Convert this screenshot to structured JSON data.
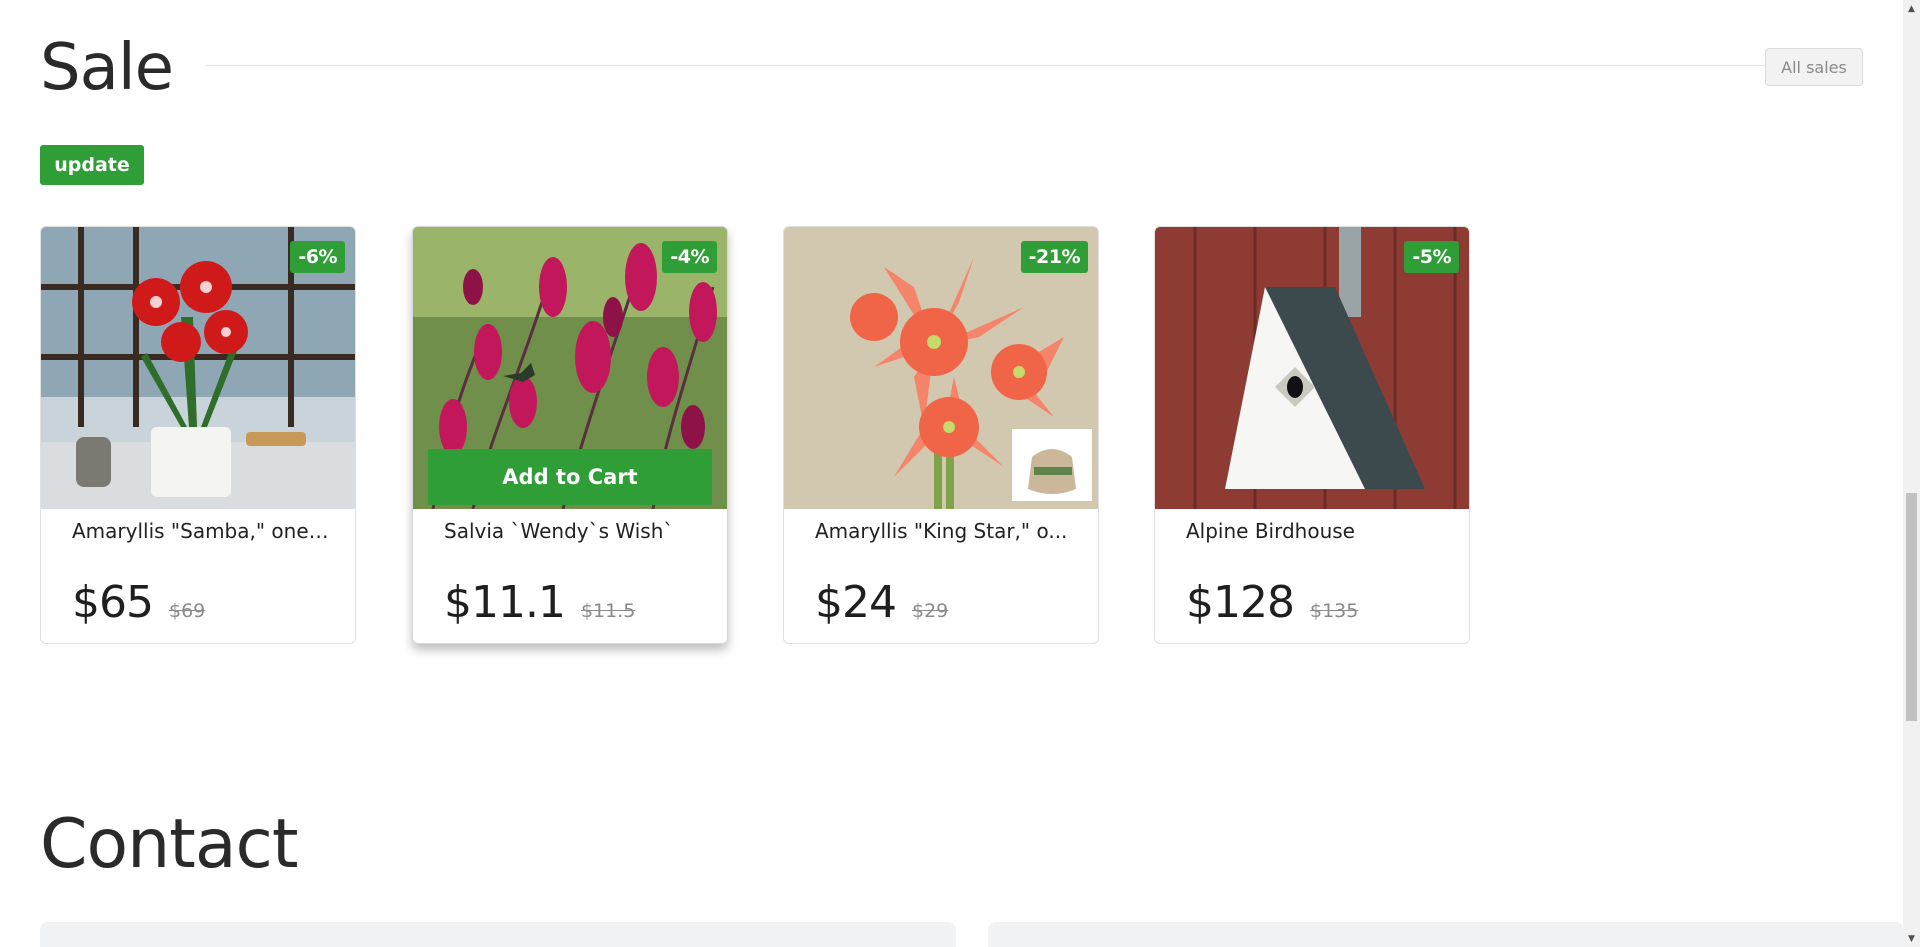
{
  "sale": {
    "title": "Sale",
    "all_sales_label": "All sales",
    "update_label": "update"
  },
  "products": [
    {
      "name": "Amaryllis \"Samba,\" one ...",
      "price": "$65",
      "old_price": "$69",
      "discount": "-6%",
      "image_icon": "red-amaryllis-photo"
    },
    {
      "name": "Salvia `Wendy`s Wish`",
      "price": "$11.1",
      "old_price": "$11.5",
      "discount": "-4%",
      "image_icon": "salvia-hummingbird-photo",
      "add_to_cart_label": "Add to Cart"
    },
    {
      "name": "Amaryllis \"King Star,\" o...",
      "price": "$24",
      "old_price": "$29",
      "discount": "-21%",
      "image_icon": "coral-amaryllis-photo"
    },
    {
      "name": "Alpine Birdhouse",
      "price": "$128",
      "old_price": "$135",
      "discount": "-5%",
      "image_icon": "birdhouse-photo"
    }
  ],
  "contact": {
    "title": "Contact"
  },
  "colors": {
    "accent": "#2f9e36",
    "text": "#222222",
    "muted": "#8a8a8a"
  }
}
